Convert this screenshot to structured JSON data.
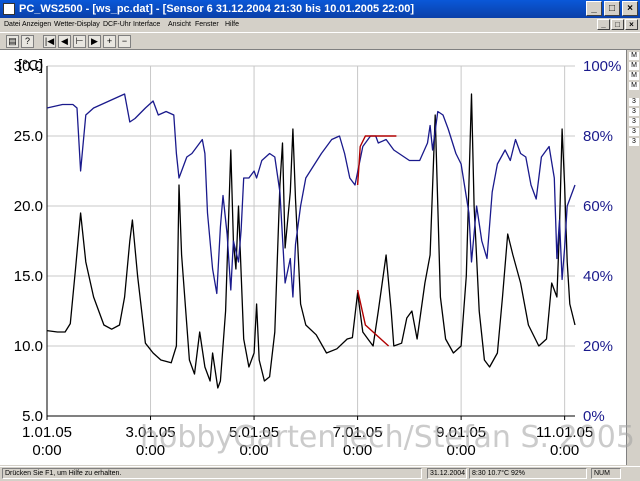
{
  "window": {
    "title": "PC_WS2500 - [ws_pc.dat] - [Sensor 6    31.12.2004    21:30    bis  10.01.2005    22:00]",
    "buttons": [
      "_",
      "□",
      "×"
    ],
    "mdi_buttons": [
      "_",
      "□",
      "×"
    ]
  },
  "menu": [
    "Datei",
    "Anzeigen",
    "Wetter-Display",
    "DCF-Uhr",
    "Interface",
    "Ansicht",
    "Fenster",
    "Hilfe"
  ],
  "toolbar": {
    "icons": [
      "print-icon",
      "help-pointer-icon",
      "first-icon",
      "prev-icon",
      "range-icon",
      "next-icon",
      "zoom-in-icon",
      "zoom-out-icon"
    ]
  },
  "sidebar": [
    "M",
    "M",
    "M",
    "M",
    "3",
    "3",
    "3",
    "3",
    "3"
  ],
  "chart_data": {
    "type": "line",
    "left_axis_label": "[°C]",
    "y_left_ticks": [
      "30.0",
      "25.0",
      "20.0",
      "15.0",
      "10.0",
      "5.0"
    ],
    "y_left_range": [
      5,
      30
    ],
    "y_right_ticks": [
      "100%",
      "80%",
      "60%",
      "40%",
      "20%",
      "0%"
    ],
    "y_right_range": [
      0,
      100
    ],
    "x_ticks": [
      {
        "date": "1.01.05",
        "time": "0:00"
      },
      {
        "date": "3.01.05",
        "time": "0:00"
      },
      {
        "date": "5.01.05",
        "time": "0:00"
      },
      {
        "date": "7.01.05",
        "time": "0:00"
      },
      {
        "date": "9.01.05",
        "time": "0:00"
      },
      {
        "date": "11.01.05",
        "time": "0:00"
      }
    ],
    "x_range": [
      "31.12.2004 21:30",
      "10.01.2005 22:00"
    ],
    "grid": true,
    "colors": {
      "temperature": "#000000",
      "humidity": "#1a1a8c",
      "highlight": "#b00000",
      "ticks_right": "#1a1a8c"
    },
    "series": [
      {
        "unit": "°C",
        "axis": "left",
        "color": "#000000",
        "points": [
          [
            0.0,
            11.1
          ],
          [
            0.2,
            11.0
          ],
          [
            0.35,
            11.0
          ],
          [
            0.45,
            11.6
          ],
          [
            0.55,
            15.5
          ],
          [
            0.65,
            19.5
          ],
          [
            0.75,
            16.0
          ],
          [
            0.9,
            13.5
          ],
          [
            1.1,
            11.5
          ],
          [
            1.25,
            11.2
          ],
          [
            1.4,
            11.5
          ],
          [
            1.5,
            13.5
          ],
          [
            1.6,
            17.5
          ],
          [
            1.65,
            19.0
          ],
          [
            1.75,
            15.0
          ],
          [
            1.9,
            10.2
          ],
          [
            2.05,
            9.5
          ],
          [
            2.2,
            9.0
          ],
          [
            2.4,
            8.8
          ],
          [
            2.5,
            10.0
          ],
          [
            2.55,
            21.5
          ],
          [
            2.6,
            16.5
          ],
          [
            2.7,
            11.5
          ],
          [
            2.75,
            9.0
          ],
          [
            2.85,
            8.0
          ],
          [
            2.95,
            11.0
          ],
          [
            3.05,
            8.5
          ],
          [
            3.15,
            7.5
          ],
          [
            3.2,
            9.5
          ],
          [
            3.3,
            7.0
          ],
          [
            3.35,
            7.5
          ],
          [
            3.45,
            12.5
          ],
          [
            3.55,
            24.0
          ],
          [
            3.6,
            17.5
          ],
          [
            3.65,
            15.5
          ],
          [
            3.7,
            20.0
          ],
          [
            3.8,
            10.5
          ],
          [
            3.9,
            8.5
          ],
          [
            4.0,
            9.5
          ],
          [
            4.05,
            13.0
          ],
          [
            4.1,
            9.0
          ],
          [
            4.2,
            7.5
          ],
          [
            4.3,
            7.8
          ],
          [
            4.4,
            11.0
          ],
          [
            4.5,
            21.5
          ],
          [
            4.55,
            24.5
          ],
          [
            4.6,
            17.0
          ],
          [
            4.7,
            21.0
          ],
          [
            4.75,
            25.5
          ],
          [
            4.8,
            20.5
          ],
          [
            4.9,
            13.0
          ],
          [
            5.0,
            11.5
          ],
          [
            5.2,
            10.8
          ],
          [
            5.4,
            9.5
          ],
          [
            5.6,
            9.8
          ],
          [
            5.8,
            10.5
          ],
          [
            5.9,
            10.6
          ],
          [
            6.0,
            13.8
          ],
          [
            6.1,
            11.0
          ],
          [
            6.2,
            10.5
          ],
          [
            6.3,
            10.0
          ],
          [
            6.4,
            12.5
          ],
          [
            6.55,
            16.5
          ],
          [
            6.65,
            12.5
          ],
          [
            6.7,
            10.0
          ],
          [
            6.85,
            10.2
          ],
          [
            6.95,
            12.0
          ],
          [
            7.05,
            12.5
          ],
          [
            7.15,
            10.5
          ],
          [
            7.3,
            14.5
          ],
          [
            7.4,
            16.5
          ],
          [
            7.5,
            26.5
          ],
          [
            7.55,
            20.0
          ],
          [
            7.6,
            13.5
          ],
          [
            7.7,
            10.5
          ],
          [
            7.85,
            9.5
          ],
          [
            8.0,
            10.0
          ],
          [
            8.1,
            15.0
          ],
          [
            8.2,
            28.0
          ],
          [
            8.25,
            20.0
          ],
          [
            8.35,
            12.5
          ],
          [
            8.45,
            9.0
          ],
          [
            8.55,
            8.5
          ],
          [
            8.7,
            9.5
          ],
          [
            8.8,
            13.5
          ],
          [
            8.9,
            18.0
          ],
          [
            9.0,
            16.5
          ],
          [
            9.15,
            14.5
          ],
          [
            9.3,
            11.5
          ],
          [
            9.5,
            10.0
          ],
          [
            9.65,
            10.5
          ],
          [
            9.75,
            14.5
          ],
          [
            9.85,
            13.5
          ],
          [
            9.9,
            18.5
          ],
          [
            9.95,
            25.5
          ],
          [
            10.0,
            21.5
          ],
          [
            10.05,
            16.0
          ],
          [
            10.1,
            13.0
          ],
          [
            10.2,
            11.5
          ]
        ]
      },
      {
        "unit": "%",
        "axis": "right",
        "color": "#1a1a8c",
        "points": [
          [
            0.0,
            88
          ],
          [
            0.3,
            89
          ],
          [
            0.5,
            89
          ],
          [
            0.58,
            88
          ],
          [
            0.65,
            70
          ],
          [
            0.75,
            86
          ],
          [
            0.9,
            88
          ],
          [
            1.2,
            90
          ],
          [
            1.5,
            92
          ],
          [
            1.6,
            84
          ],
          [
            1.7,
            85
          ],
          [
            1.9,
            88
          ],
          [
            2.05,
            90
          ],
          [
            2.15,
            86
          ],
          [
            2.3,
            87
          ],
          [
            2.45,
            86
          ],
          [
            2.5,
            75
          ],
          [
            2.55,
            68
          ],
          [
            2.7,
            74
          ],
          [
            2.8,
            75
          ],
          [
            2.9,
            77
          ],
          [
            3.0,
            79
          ],
          [
            3.05,
            75
          ],
          [
            3.1,
            58
          ],
          [
            3.2,
            42
          ],
          [
            3.28,
            35
          ],
          [
            3.35,
            54
          ],
          [
            3.4,
            63
          ],
          [
            3.48,
            52
          ],
          [
            3.55,
            36
          ],
          [
            3.6,
            50
          ],
          [
            3.7,
            44
          ],
          [
            3.75,
            53
          ],
          [
            3.8,
            68
          ],
          [
            3.9,
            68
          ],
          [
            4.0,
            70
          ],
          [
            4.05,
            68
          ],
          [
            4.15,
            73
          ],
          [
            4.3,
            75
          ],
          [
            4.4,
            74
          ],
          [
            4.5,
            64
          ],
          [
            4.6,
            38
          ],
          [
            4.7,
            45
          ],
          [
            4.75,
            34
          ],
          [
            4.8,
            49
          ],
          [
            4.9,
            60
          ],
          [
            5.0,
            68
          ],
          [
            5.3,
            75
          ],
          [
            5.5,
            79
          ],
          [
            5.65,
            80
          ],
          [
            5.75,
            75
          ],
          [
            5.85,
            68
          ],
          [
            5.95,
            66
          ],
          [
            6.1,
            77
          ],
          [
            6.25,
            80
          ],
          [
            6.35,
            80
          ],
          [
            6.4,
            78
          ],
          [
            6.55,
            79
          ],
          [
            6.7,
            76
          ],
          [
            6.9,
            74
          ],
          [
            7.0,
            73
          ],
          [
            7.2,
            73
          ],
          [
            7.35,
            78
          ],
          [
            7.4,
            83
          ],
          [
            7.45,
            76
          ],
          [
            7.55,
            87
          ],
          [
            7.65,
            86
          ],
          [
            7.75,
            82
          ],
          [
            7.9,
            75
          ],
          [
            8.0,
            72
          ],
          [
            8.15,
            58
          ],
          [
            8.2,
            44
          ],
          [
            8.3,
            60
          ],
          [
            8.4,
            50
          ],
          [
            8.5,
            45
          ],
          [
            8.6,
            64
          ],
          [
            8.7,
            72
          ],
          [
            8.85,
            76
          ],
          [
            8.95,
            73
          ],
          [
            9.05,
            79
          ],
          [
            9.15,
            75
          ],
          [
            9.25,
            74
          ],
          [
            9.35,
            66
          ],
          [
            9.45,
            62
          ],
          [
            9.55,
            74
          ],
          [
            9.7,
            77
          ],
          [
            9.8,
            68
          ],
          [
            9.85,
            45
          ],
          [
            9.9,
            56
          ],
          [
            9.95,
            39
          ],
          [
            10.0,
            48
          ],
          [
            10.05,
            60
          ],
          [
            10.15,
            64
          ],
          [
            10.2,
            66
          ]
        ]
      }
    ],
    "highlight_segments": [
      {
        "series_unit": "°C",
        "points": [
          [
            6.0,
            14.0
          ],
          [
            6.15,
            11.5
          ],
          [
            6.3,
            11.0
          ],
          [
            6.6,
            10.0
          ]
        ]
      },
      {
        "series_unit": "%",
        "points": [
          [
            6.0,
            66
          ],
          [
            6.02,
            70
          ],
          [
            6.05,
            77
          ],
          [
            6.15,
            80
          ],
          [
            6.35,
            80
          ],
          [
            6.55,
            80
          ],
          [
            6.75,
            80
          ]
        ]
      }
    ]
  },
  "status": {
    "hint": "Drücken Sie F1, um Hilfe zu erhalten.",
    "date": "31.12.2004",
    "info": "8:30   10.7°C  92%",
    "num": "NUM"
  },
  "watermark": "hobbyGartenTech/Stefan S. 2005"
}
